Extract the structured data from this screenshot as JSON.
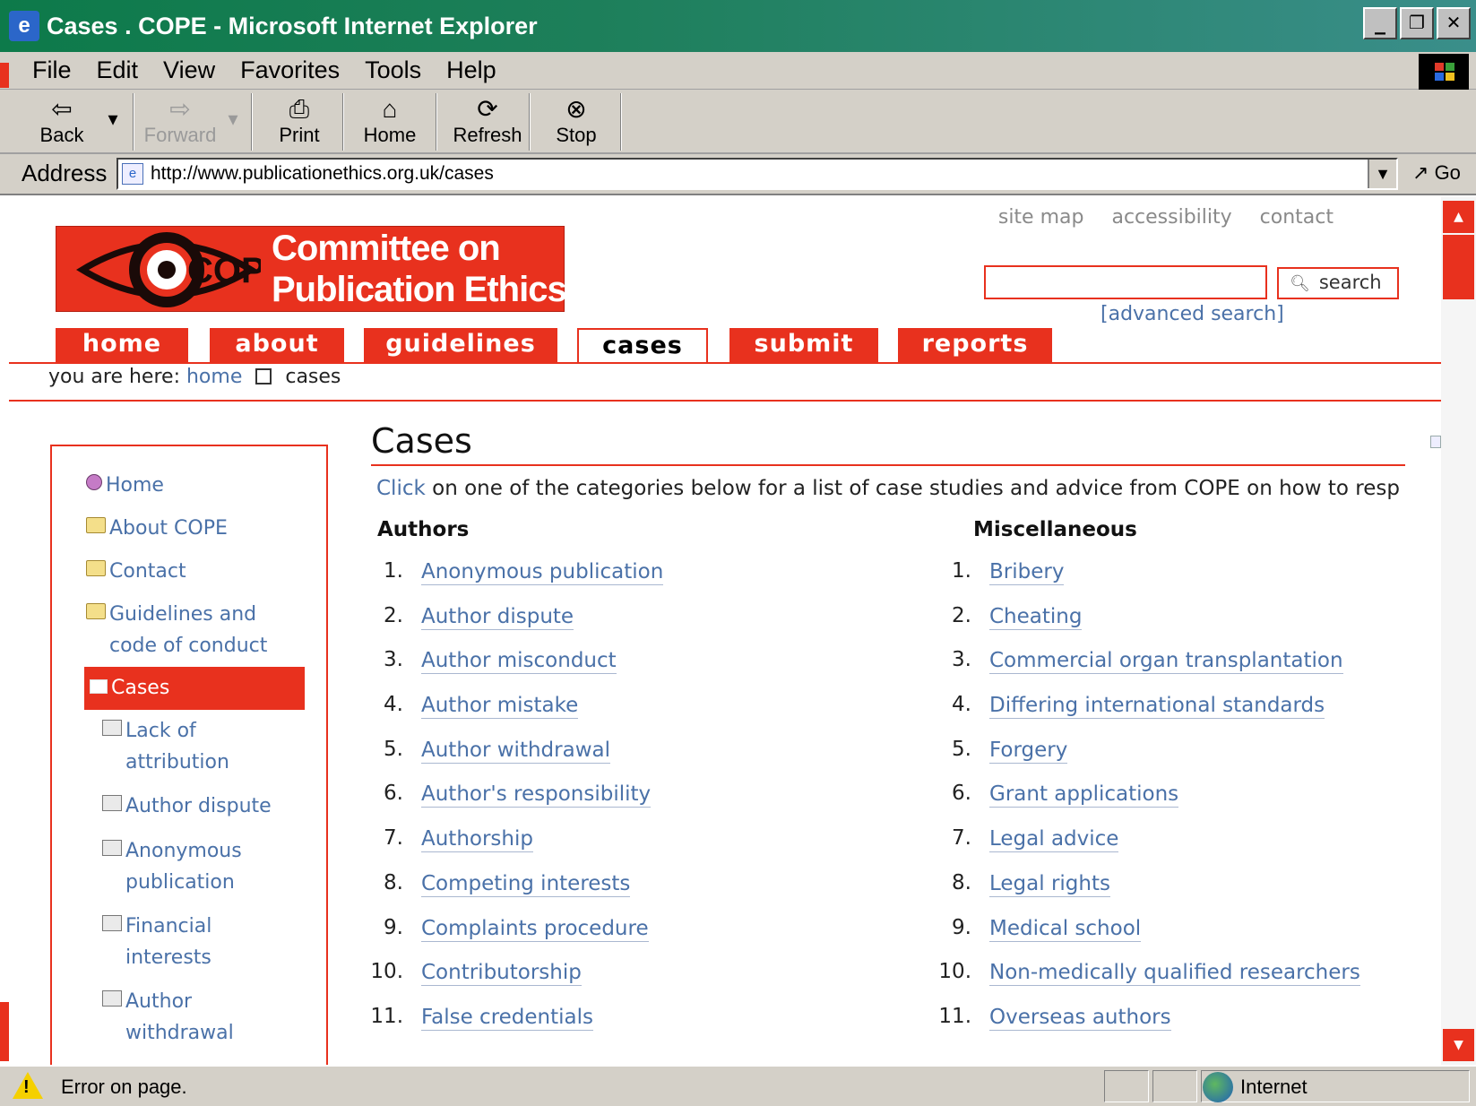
{
  "window": {
    "title": "Cases . COPE - Microsoft Internet Explorer",
    "minimize": "_",
    "restore": "❐",
    "close": "✕"
  },
  "menu": [
    "File",
    "Edit",
    "View",
    "Favorites",
    "Tools",
    "Help"
  ],
  "toolbar": {
    "back": "Back",
    "forward": "Forward",
    "print": "Print",
    "home": "Home",
    "refresh": "Refresh",
    "stop": "Stop"
  },
  "address": {
    "label": "Address",
    "url": "http://www.publicationethics.org.uk/cases",
    "go": "Go"
  },
  "site": {
    "logo_line1": "Committee on",
    "logo_line2": "Publication Ethics",
    "logo_mark": "COPE",
    "top_links": [
      "site map",
      "accessibility",
      "contact"
    ],
    "search_button": "search",
    "advanced_search": "[advanced search]",
    "tabs": [
      "home",
      "about",
      "guidelines",
      "cases",
      "submit",
      "reports"
    ],
    "active_tab": "cases",
    "breadcrumb": {
      "prefix": "you are here:",
      "home": "home",
      "current": "cases"
    }
  },
  "leftnav": {
    "items": [
      "Home",
      "About COPE",
      "Contact"
    ],
    "guidelines_line1": "Guidelines and",
    "guidelines_line2": "code of conduct",
    "active": "Cases",
    "sub": [
      {
        "l1": "Lack of",
        "l2": "attribution"
      },
      {
        "l1": "Author dispute",
        "l2": ""
      },
      {
        "l1": "Anonymous",
        "l2": "publication"
      },
      {
        "l1": "Financial",
        "l2": "interests"
      },
      {
        "l1": "Author",
        "l2": "withdrawal"
      }
    ]
  },
  "main": {
    "heading": "Cases",
    "intro_link": "Click",
    "intro_rest": " on one of the categories below for a list of case studies and advice from COPE on how to resp",
    "authors_heading": "Authors",
    "misc_heading": "Miscellaneous",
    "authors": [
      "Anonymous publication",
      "Author dispute",
      "Author misconduct",
      "Author mistake",
      "Author withdrawal",
      "Author's responsibility",
      "Authorship",
      "Competing interests",
      "Complaints procedure",
      "Contributorship",
      "False credentials"
    ],
    "misc": [
      "Bribery",
      "Cheating",
      "Commercial organ transplantation",
      "Differing international standards",
      "Forgery",
      "Grant applications",
      "Legal advice",
      "Legal rights",
      "Medical school",
      "Non-medically qualified researchers",
      "Overseas authors"
    ],
    "numbers": [
      "1.",
      "2.",
      "3.",
      "4.",
      "5.",
      "6.",
      "7.",
      "8.",
      "9.",
      "10.",
      "11."
    ]
  },
  "status": {
    "text": "Error on page.",
    "zone": "Internet"
  },
  "colors": {
    "brand_red": "#e8311e",
    "link_blue": "#4a71a8"
  }
}
